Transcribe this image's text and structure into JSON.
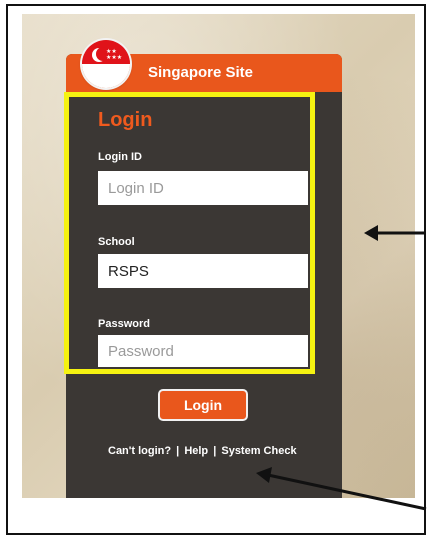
{
  "header": {
    "site_title": "Singapore Site"
  },
  "form": {
    "heading": "Login",
    "login_id_label": "Login ID",
    "login_id_placeholder": "Login ID",
    "school_label": "School",
    "school_value": "RSPS",
    "password_label": "Password",
    "password_placeholder": "Password",
    "login_button": "Login"
  },
  "links": {
    "cant_login": "Can't login?",
    "separator": "|",
    "help": "Help",
    "system_check": "System Check"
  },
  "colors": {
    "accent": "#e9571c",
    "panel": "#3b3734",
    "highlight": "#f5f211"
  }
}
